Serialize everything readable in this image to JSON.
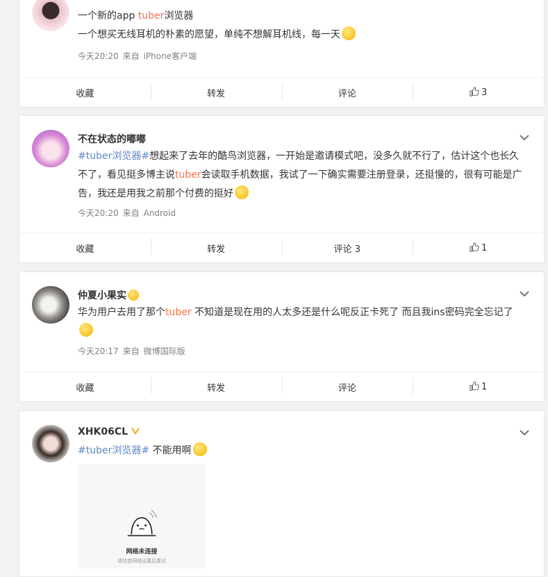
{
  "colors": {
    "highlight": "#eb7350",
    "topic": "#5d8ac6",
    "meta": "#808080"
  },
  "posts": [
    {
      "name": "",
      "title_line": "一个新的app ",
      "title_hl": "tuber",
      "title_rest": "浏览器",
      "text": "一个想买无线耳机的朴素的愿望，单纯不想解耳机线，每一天",
      "time": "今天20:20",
      "source_prefix": "来自",
      "source": "iPhone客户端",
      "actions": {
        "fav": "收藏",
        "repost": "转发",
        "comment": "评论",
        "like": "3"
      }
    },
    {
      "name": "不在状态的嘟嘟",
      "topic": "#tuber浏览器#",
      "text_a": "想起来了去年的酷鸟浏览器，一开始是邀请模式吧，没多久就不行了，估计这个也长久不了，看见挺多博主说",
      "text_hl": "tuber",
      "text_b": "会读取手机数据，我试了一下确实需要注册登录，还挺慢的，很有可能是广告，我还是用我之前那个付费的挺好",
      "time": "今天20:20",
      "source_prefix": "来自",
      "source": "Android",
      "actions": {
        "fav": "收藏",
        "repost": "转发",
        "comment": "评论 3",
        "like": "1"
      }
    },
    {
      "name": "仲夏小果实",
      "text_a": "华为用户去用了那个",
      "text_hl": "tuber",
      "text_b": " 不知道是现在用的人太多还是什么呢反正卡死了 而且我ins密码完全忘记了",
      "time": "今天20:17",
      "source_prefix": "来自",
      "source": "微博国际版",
      "actions": {
        "fav": "收藏",
        "repost": "转发",
        "comment": "评论",
        "like": "1"
      }
    },
    {
      "name": "XHK06CL",
      "topic": "#tuber浏览器#",
      "text": " 不能用啊",
      "image_title": "网络未连接",
      "image_sub": "请检查网络设置后重试"
    }
  ]
}
